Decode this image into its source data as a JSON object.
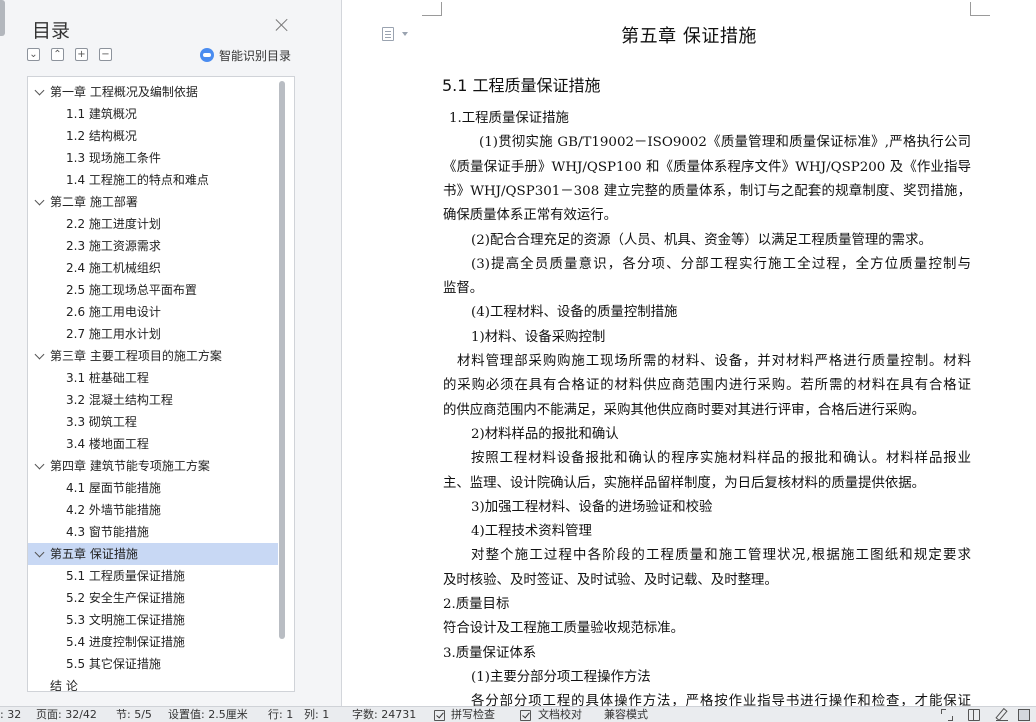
{
  "toc_panel": {
    "title": "目录",
    "toolbar": {
      "collapse_all": "⌄",
      "expand_up": "⌃",
      "add": "+",
      "remove": "−",
      "smart_toc_label": "智能识别目录"
    },
    "items": [
      {
        "level": 1,
        "label": "第一章   工程概况及编制依据",
        "expanded": true,
        "selected": false
      },
      {
        "level": 2,
        "label": "1.1  建筑概况"
      },
      {
        "level": 2,
        "label": "1.2  结构概况"
      },
      {
        "level": 2,
        "label": "1.3  现场施工条件"
      },
      {
        "level": 2,
        "label": "1.4  工程施工的特点和难点"
      },
      {
        "level": 1,
        "label": "第二章   施工部署",
        "expanded": true,
        "selected": false
      },
      {
        "level": 2,
        "label": "2.2  施工进度计划"
      },
      {
        "level": 2,
        "label": "2.3  施工资源需求"
      },
      {
        "level": 2,
        "label": "2.4  施工机械组织"
      },
      {
        "level": 2,
        "label": "2.5  施工现场总平面布置"
      },
      {
        "level": 2,
        "label": "2.6  施工用电设计"
      },
      {
        "level": 2,
        "label": "2.7  施工用水计划"
      },
      {
        "level": 1,
        "label": "第三章  主要工程项目的施工方案",
        "expanded": true,
        "selected": false
      },
      {
        "level": 2,
        "label": "3.1  桩基础工程"
      },
      {
        "level": 2,
        "label": "3.2  混凝土结构工程"
      },
      {
        "level": 2,
        "label": "3.3  砌筑工程"
      },
      {
        "level": 2,
        "label": "3.4  楼地面工程"
      },
      {
        "level": 1,
        "label": "第四章   建筑节能专项施工方案",
        "expanded": true,
        "selected": false
      },
      {
        "level": 2,
        "label": "4.1  屋面节能措施"
      },
      {
        "level": 2,
        "label": "4.2  外墙节能措施"
      },
      {
        "level": 2,
        "label": "4.3  窗节能措施"
      },
      {
        "level": 1,
        "label": "第五章   保证措施",
        "expanded": true,
        "selected": true
      },
      {
        "level": 2,
        "label": "5.1  工程质量保证措施"
      },
      {
        "level": 2,
        "label": "5.2  安全生产保证措施"
      },
      {
        "level": 2,
        "label": "5.3  文明施工保证措施"
      },
      {
        "level": 2,
        "label": "5.4  进度控制保证措施"
      },
      {
        "level": 2,
        "label": "5.5  其它保证措施"
      },
      {
        "level": 1,
        "label": "结  论",
        "expanded": false,
        "selected": false
      }
    ]
  },
  "document": {
    "chapter_title": "第五章    保证措施",
    "section_heading": "5.1  工程质量保证措施",
    "lines": [
      {
        "text": "1.工程质量保证措施",
        "indent": 6,
        "justify": false
      },
      {
        "text": "(1)贯彻实施 GB/T19002－ISO9002《质量管理和质量保证标准》,严格执行公司",
        "indent": 36,
        "justify": true
      },
      {
        "text": "《质量保证手册》WHJ/QSP100 和《质量体系程序文件》WHJ/QSP200 及《作业指导",
        "indent": 0,
        "justify": true
      },
      {
        "text": "书》WHJ/QSP301－308 建立完整的质量体系，制订与之配套的规章制度、奖罚措施，",
        "indent": 0,
        "justify": true
      },
      {
        "text": "确保质量体系正常有效运行。",
        "indent": 0,
        "justify": false
      },
      {
        "text": "(2)配合合理充足的资源（人员、机具、资金等）以满足工程质量管理的需求。",
        "indent": 28,
        "justify": false
      },
      {
        "text": "(3)提高全员质量意识，各分项、分部工程实行施工全过程，全方位质量控制与",
        "indent": 28,
        "justify": true
      },
      {
        "text": "监督。",
        "indent": 0,
        "justify": false
      },
      {
        "text": "(4)工程材料、设备的质量控制措施",
        "indent": 28,
        "justify": false
      },
      {
        "text": "1)材料、设备采购控制",
        "indent": 28,
        "justify": false
      },
      {
        "text": "材料管理部采购购施工现场所需的材料、设备，并对材料严格进行质量控制。材料",
        "indent": 14,
        "justify": true
      },
      {
        "text": "的采购必须在具有合格证的材料供应商范围内进行采购。若所需的材料在具有合格证",
        "indent": 0,
        "justify": true
      },
      {
        "text": "的供应商范围内不能满足，采购其他供应商时要对其进行评审，合格后进行采购。",
        "indent": 0,
        "justify": false
      },
      {
        "text": "2)材料样品的报批和确认",
        "indent": 28,
        "justify": false
      },
      {
        "text": "按照工程材料设备报批和确认的程序实施材料样品的报批和确认。材料样品报业",
        "indent": 28,
        "justify": true
      },
      {
        "text": "主、监理、设计院确认后，实施样品留样制度，为日后复核材料的质量提供依据。",
        "indent": 0,
        "justify": false
      },
      {
        "text": "3)加强工程材料、设备的进场验证和校验",
        "indent": 28,
        "justify": false
      },
      {
        "text": "4)工程技术资料管理",
        "indent": 28,
        "justify": false
      },
      {
        "text": "对整个施工过程中各阶段的工程质量和施工管理状况,根据施工图纸和规定要求",
        "indent": 28,
        "justify": true
      },
      {
        "text": "及时核验、及时签证、及时试验、及时记载、及时整理。",
        "indent": 0,
        "justify": false
      },
      {
        "text": "2.质量目标",
        "indent": 0,
        "justify": false
      },
      {
        "text": "符合设计及工程施工质量验收规范标准。",
        "indent": 0,
        "justify": false
      },
      {
        "text": "3.质量保证体系",
        "indent": 0,
        "justify": false
      },
      {
        "text": "(1)主要分部分项工程操作方法",
        "indent": 28,
        "justify": false
      },
      {
        "text": "各分部分项工程的具体操作方法，严格按作业指导书进行操作和检查，才能保证",
        "indent": 28,
        "justify": true
      }
    ]
  },
  "status_bar": {
    "page_left_value": ": 32",
    "page_count": "页面: 32/42",
    "section": "节: 5/5",
    "setting": "设置值: 2.5厘米",
    "row": "行: 1",
    "col": "列: 1",
    "word_count": "字数: 24731",
    "spell_check": "拼写检查",
    "doc_proof": "文档校对",
    "compat_mode": "兼容模式"
  }
}
